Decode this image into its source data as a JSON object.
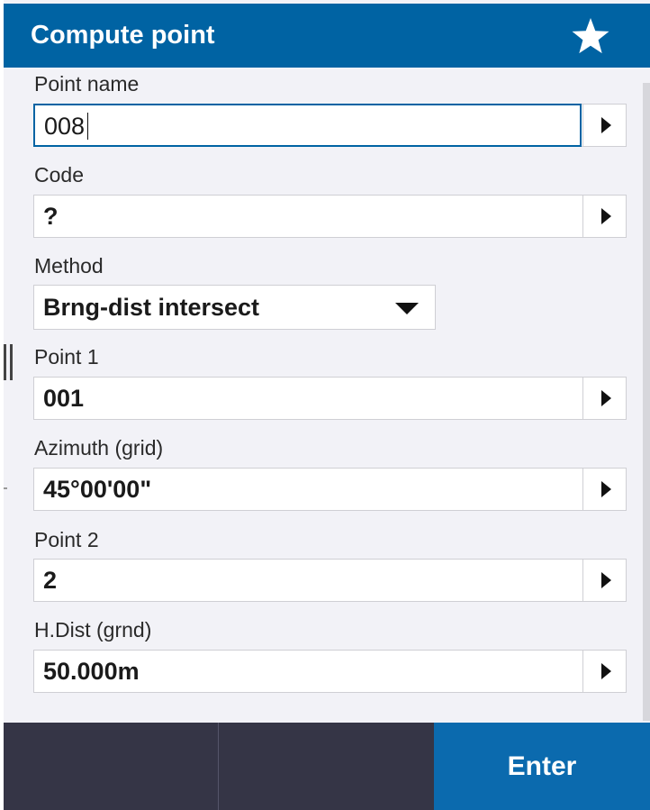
{
  "header": {
    "title": "Compute point",
    "favorite_icon": "star-icon"
  },
  "colors": {
    "header_bg": "#0063a3",
    "panel_bg": "#f2f2f7",
    "footer_bg": "#353546",
    "enter_bg": "#0b6aae"
  },
  "form": {
    "point_name": {
      "label": "Point name",
      "value": "008"
    },
    "code": {
      "label": "Code",
      "value": "?"
    },
    "method": {
      "label": "Method",
      "value": "Brng-dist intersect"
    },
    "point1": {
      "label": "Point 1",
      "value": "001"
    },
    "azimuth": {
      "label": "Azimuth (grid)",
      "value": "45°00'00\""
    },
    "point2": {
      "label": "Point 2",
      "value": "2"
    },
    "hdist": {
      "label": "H.Dist (grnd)",
      "value": "50.000m"
    }
  },
  "footer": {
    "enter_label": "Enter"
  }
}
